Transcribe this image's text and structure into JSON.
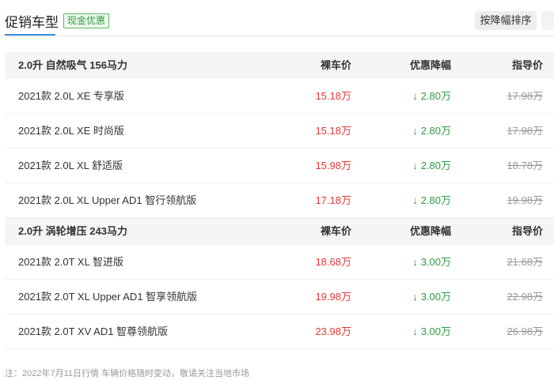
{
  "header": {
    "active_tab": "促销车型",
    "badge": "现金优惠",
    "sort_button": "按降幅排序"
  },
  "columns": {
    "price": "裸车价",
    "discount": "优惠降幅",
    "guide": "指导价"
  },
  "groups": [
    {
      "title": "2.0升 自然吸气 156马力",
      "rows": [
        {
          "name": "2021款 2.0L XE 专享版",
          "price": "15.18万",
          "discount": "2.80万",
          "guide": "17.98万"
        },
        {
          "name": "2021款 2.0L XE 时尚版",
          "price": "15.18万",
          "discount": "2.80万",
          "guide": "17.98万"
        },
        {
          "name": "2021款 2.0L XL 舒适版",
          "price": "15.98万",
          "discount": "2.80万",
          "guide": "18.78万"
        },
        {
          "name": "2021款 2.0L XL Upper AD1 智行领航版",
          "price": "17.18万",
          "discount": "2.80万",
          "guide": "19.98万"
        }
      ]
    },
    {
      "title": "2.0升 涡轮增压 243马力",
      "rows": [
        {
          "name": "2021款 2.0T XL 智进版",
          "price": "18.68万",
          "discount": "3.00万",
          "guide": "21.68万"
        },
        {
          "name": "2021款 2.0T XL Upper AD1 智享领航版",
          "price": "19.98万",
          "discount": "3.00万",
          "guide": "22.98万"
        },
        {
          "name": "2021款 2.0T XV AD1 智尊领航版",
          "price": "23.98万",
          "discount": "3.00万",
          "guide": "26.98万"
        }
      ]
    }
  ],
  "footnote": "注：2022年7月11日行情 车辆价格随时变动，敬请关注当地市场",
  "colors": {
    "price": "#e03a3a",
    "discount": "#2e9d41",
    "accent": "#3a8ee6"
  },
  "icons": {
    "discount": "down-arrow-icon"
  }
}
